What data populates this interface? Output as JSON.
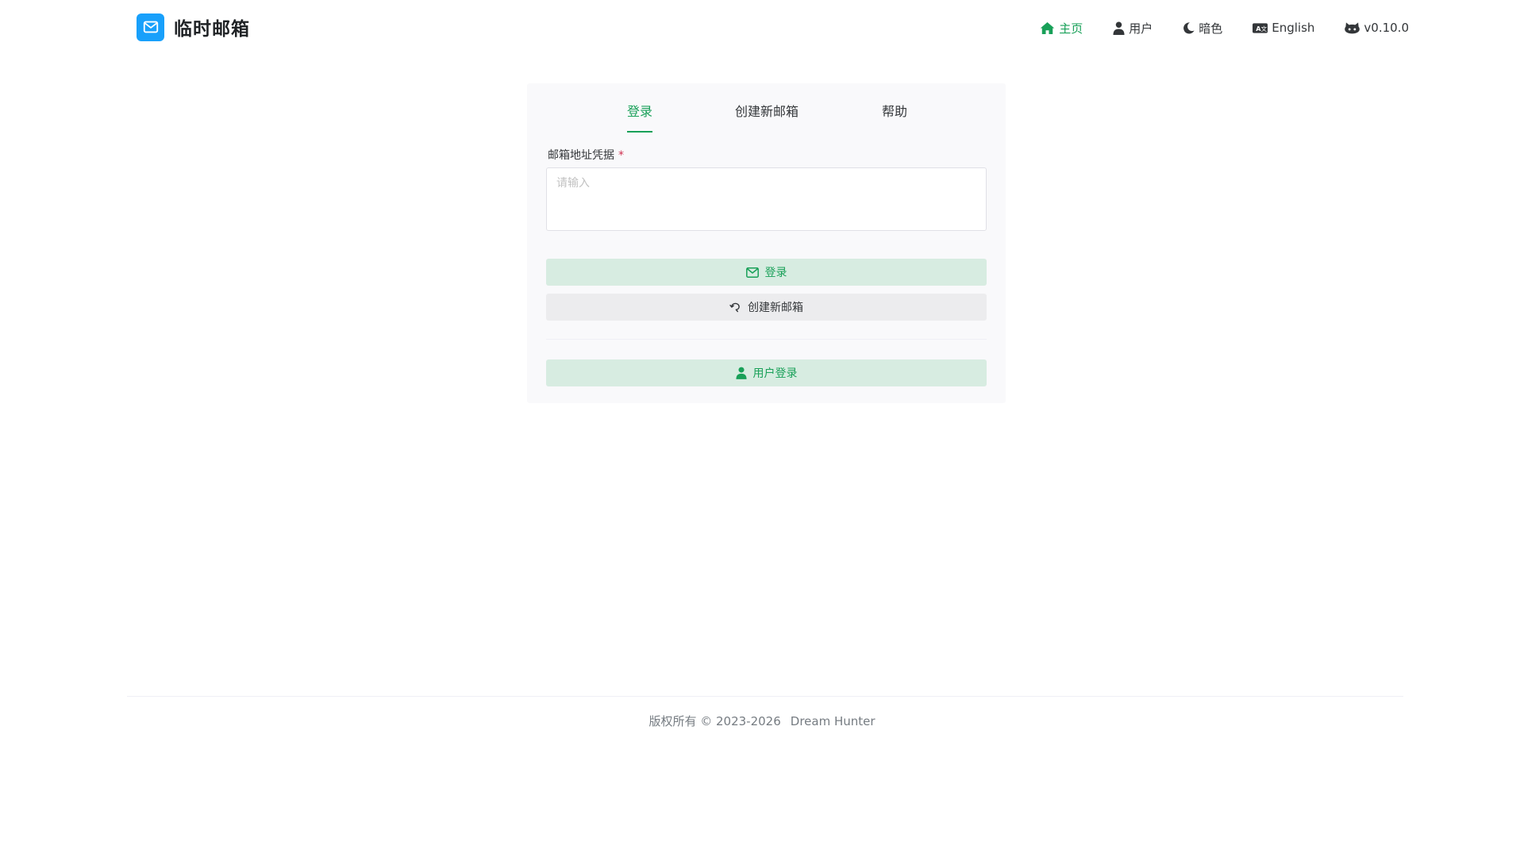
{
  "header": {
    "title": "临时邮箱",
    "nav": [
      {
        "label": "主页",
        "icon": "home-icon",
        "active": true
      },
      {
        "label": "用户",
        "icon": "user-icon",
        "active": false
      },
      {
        "label": "暗色",
        "icon": "moon-icon",
        "active": false
      },
      {
        "label": "English",
        "icon": "language-icon",
        "active": false
      },
      {
        "label": "v0.10.0",
        "icon": "github-icon",
        "active": false
      }
    ]
  },
  "tabs": [
    {
      "label": "登录",
      "active": true
    },
    {
      "label": "创建新邮箱",
      "active": false
    },
    {
      "label": "帮助",
      "active": false
    }
  ],
  "form": {
    "credential_label": "邮箱地址凭据",
    "required_mark": "*",
    "credential_placeholder": "请输入",
    "credential_value": ""
  },
  "buttons": {
    "login": "登录",
    "create": "创建新邮箱",
    "user_login": "用户登录"
  },
  "footer": {
    "copyright": "版权所有 © 2023-2026",
    "author": "Dream Hunter"
  },
  "colors": {
    "accent": "#18a058",
    "logo": "#18a0fb",
    "required": "#d03050"
  }
}
